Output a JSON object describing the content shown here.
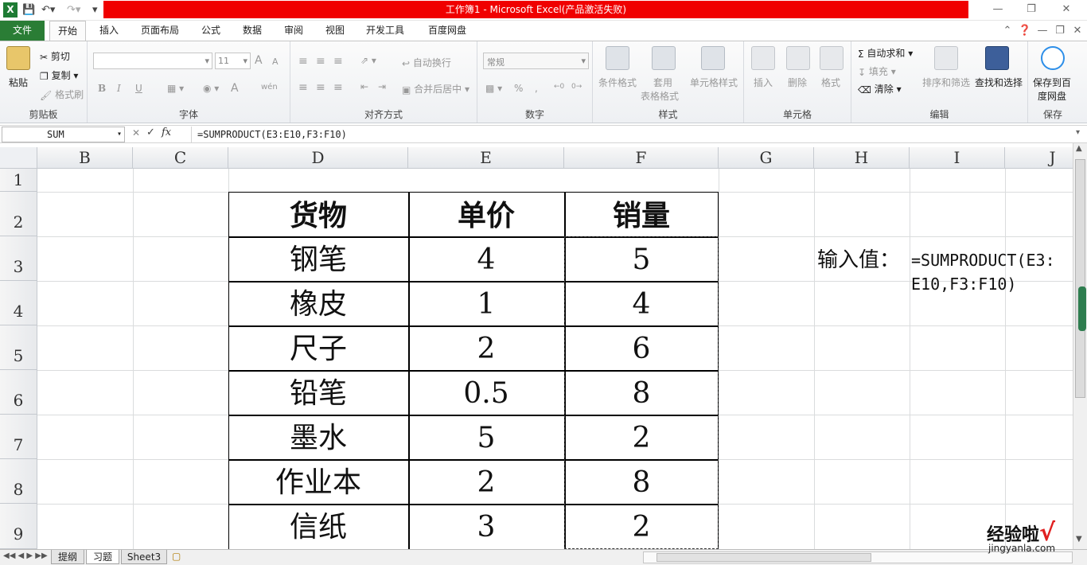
{
  "window": {
    "title": "工作簿1 -  Microsoft Excel(产品激活失败)"
  },
  "ribbon_tabs": [
    "文件",
    "开始",
    "插入",
    "页面布局",
    "公式",
    "数据",
    "审阅",
    "视图",
    "开发工具",
    "百度网盘"
  ],
  "ribbon": {
    "clipboard": {
      "paste": "粘贴",
      "cut": "剪切",
      "copy": "复制",
      "format_painter": "格式刷",
      "label": "剪贴板"
    },
    "font": {
      "size": "11",
      "bold": "B",
      "italic": "I",
      "underline": "U",
      "grow": "A",
      "shrink": "A",
      "font_color": "A",
      "phonetic": "wén",
      "label": "字体"
    },
    "alignment": {
      "wrap": "自动换行",
      "merge": "合并后居中",
      "label": "对齐方式"
    },
    "number": {
      "format": "常规",
      "percent": "%",
      "comma": ",",
      "label": "数字"
    },
    "styles": {
      "conditional": "条件格式",
      "table1": "套用",
      "table2": "表格格式",
      "cell_styles": "单元格样式",
      "label": "样式"
    },
    "cells": {
      "insert": "插入",
      "delete": "删除",
      "format": "格式",
      "label": "单元格"
    },
    "editing": {
      "autosum": "自动求和",
      "fill": "填充",
      "clear": "清除",
      "sort": "排序和筛选",
      "find": "查找和选择",
      "label": "编辑"
    },
    "save": {
      "line1": "保存到百",
      "line2": "度网盘",
      "label": "保存"
    }
  },
  "formula_bar": {
    "name_box": "SUM",
    "fx": "fx",
    "formula": "=SUMPRODUCT(E3:E10,F3:F10)"
  },
  "columns": [
    "B",
    "C",
    "D",
    "E",
    "F",
    "G",
    "H",
    "I",
    "J"
  ],
  "rows": [
    "1",
    "2",
    "3",
    "4",
    "5",
    "6",
    "7",
    "8",
    "9"
  ],
  "table": {
    "headers": [
      "货物",
      "单价",
      "销量"
    ],
    "rows": [
      [
        "钢笔",
        "4",
        "5"
      ],
      [
        "橡皮",
        "1",
        "4"
      ],
      [
        "尺子",
        "2",
        "6"
      ],
      [
        "铅笔",
        "0.5",
        "8"
      ],
      [
        "墨水",
        "5",
        "2"
      ],
      [
        "作业本",
        "2",
        "8"
      ],
      [
        "信纸",
        "3",
        "2"
      ]
    ]
  },
  "input_label": "输入值：",
  "input_formula_line1": "=SUMPRODUCT(E3:",
  "input_formula_line2": "E10,F3:F10)",
  "sheet_tabs": [
    "提纲",
    "习题",
    "Sheet3"
  ],
  "watermark": {
    "text": "经验啦",
    "check": "√",
    "url": "jingyanla.com"
  }
}
